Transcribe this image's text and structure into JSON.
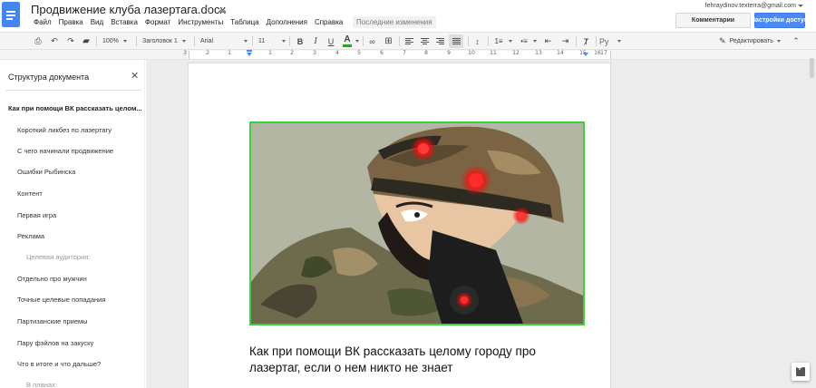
{
  "header": {
    "doc_title": "Продвижение клуба лазертага.docx",
    "star_icon": "star-icon",
    "drive_icon": "drive-icon",
    "menu": [
      "Файл",
      "Правка",
      "Вид",
      "Вставка",
      "Формат",
      "Инструменты",
      "Таблица",
      "Дополнения",
      "Справка"
    ],
    "last_edit": "Последние изменения",
    "user_email": "fehraydinov.texterra@gmail.com",
    "comments_button": "Комментарии",
    "share_button": "Настройки доступа",
    "accent_color": "#4a8af4"
  },
  "toolbar": {
    "zoom": "100%",
    "style": "Заголовок 1",
    "font": "Arial",
    "font_size": "11",
    "bold": "B",
    "italic": "I",
    "underline": "U",
    "text_color": "A",
    "text_color_value": "#00c200",
    "language": "Ру",
    "mode": "Редактировать",
    "icons": [
      "print-icon",
      "undo-icon",
      "redo-icon",
      "paint-format-icon",
      "link-icon",
      "comment-icon",
      "align-left-icon",
      "align-center-icon",
      "align-right-icon",
      "align-justify-icon",
      "line-spacing-icon",
      "numbered-list-icon",
      "bulleted-list-icon",
      "decrease-indent-icon",
      "increase-indent-icon",
      "clear-formatting-icon",
      "pencil-icon",
      "collapse-icon"
    ]
  },
  "ruler": {
    "numbers": [
      "3",
      "2",
      "1",
      "1",
      "2",
      "3",
      "4",
      "5",
      "6",
      "7",
      "8",
      "9",
      "10",
      "11",
      "12",
      "13",
      "14",
      "15",
      "16",
      "17"
    ]
  },
  "outline": {
    "title": "Структура документа",
    "items": [
      {
        "label": "Как при помощи ВК рассказать целом...",
        "level": 1
      },
      {
        "label": "Короткий ликбез по лазертагу",
        "level": 2
      },
      {
        "label": "С чего начинали продвижение",
        "level": 2
      },
      {
        "label": "Ошибки Рыбинска",
        "level": 2
      },
      {
        "label": "Контент",
        "level": 2
      },
      {
        "label": "Первая игра",
        "level": 2
      },
      {
        "label": "Реклама",
        "level": 2
      },
      {
        "label": "Целевая аудитория:",
        "level": 3
      },
      {
        "label": "Отдельно про мужчин",
        "level": 2
      },
      {
        "label": "Точные целевые попадания",
        "level": 2
      },
      {
        "label": "Партизанские приемы",
        "level": 2
      },
      {
        "label": "Пару фэйлов на закуску",
        "level": 2
      },
      {
        "label": "Что в итоге и что дальше?",
        "level": 2
      },
      {
        "label": "В планах:",
        "level": 3
      }
    ]
  },
  "document": {
    "heading": "Как при помощи ВК рассказать целому городу про лазертаг, если о нем никто не знает",
    "image_border_color": "#3cd23c"
  }
}
